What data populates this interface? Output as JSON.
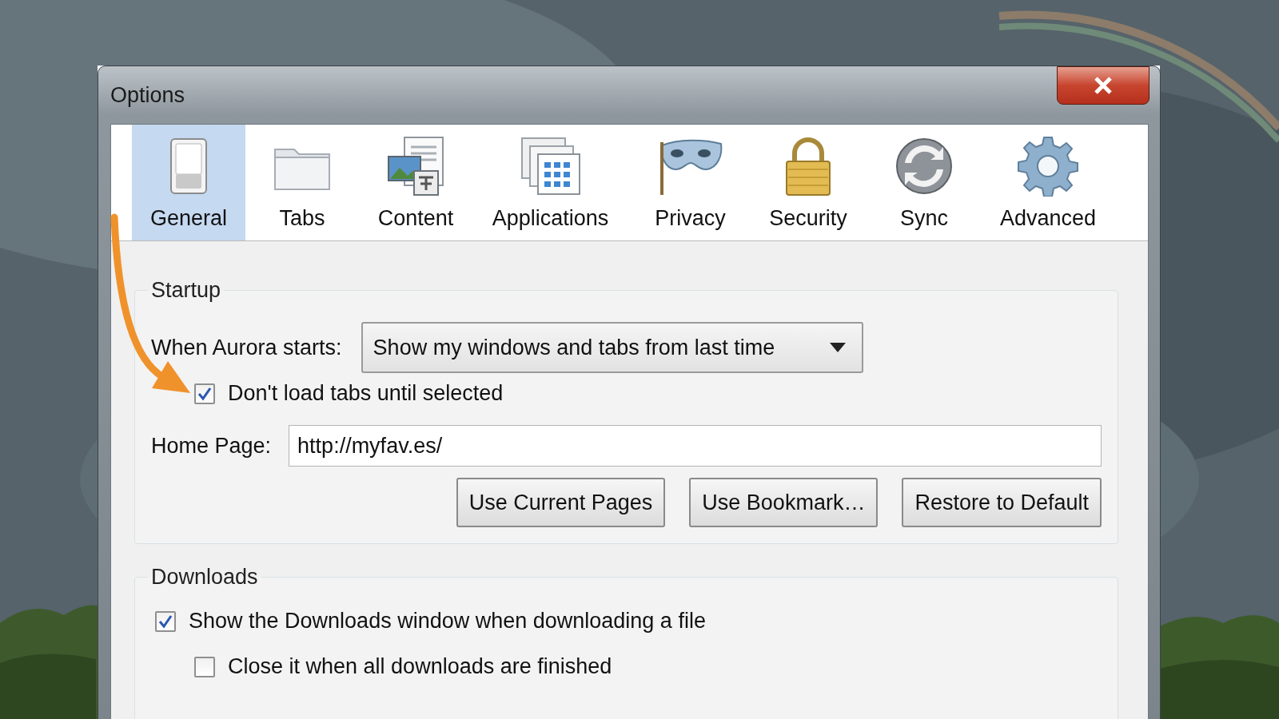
{
  "window": {
    "title": "Options"
  },
  "tabs": [
    {
      "label": "General",
      "selected": true
    },
    {
      "label": "Tabs",
      "selected": false
    },
    {
      "label": "Content",
      "selected": false
    },
    {
      "label": "Applications",
      "selected": false
    },
    {
      "label": "Privacy",
      "selected": false
    },
    {
      "label": "Security",
      "selected": false
    },
    {
      "label": "Sync",
      "selected": false
    },
    {
      "label": "Advanced",
      "selected": false
    }
  ],
  "startup": {
    "legend": "Startup",
    "when_label": {
      "text": "When Aurora starts:"
    },
    "startup_choice": "Show my windows and tabs from last time",
    "options": [
      {
        "label": "Don't load tabs until selected",
        "checked": true
      }
    ],
    "home_page": {
      "label": "Home Page:",
      "value": "http://myfav.es/"
    },
    "buttons": [
      {
        "label": "Use Current Pages"
      },
      {
        "label": "Use Bookmark…"
      },
      {
        "label": "Restore to Default"
      }
    ]
  },
  "downloads": {
    "legend": "Downloads",
    "options": [
      {
        "label": "Show the Downloads window when downloading a file",
        "checked": true,
        "children": [
          {
            "label": "Close it when all downloads are finished",
            "checked": false
          }
        ]
      }
    ]
  }
}
